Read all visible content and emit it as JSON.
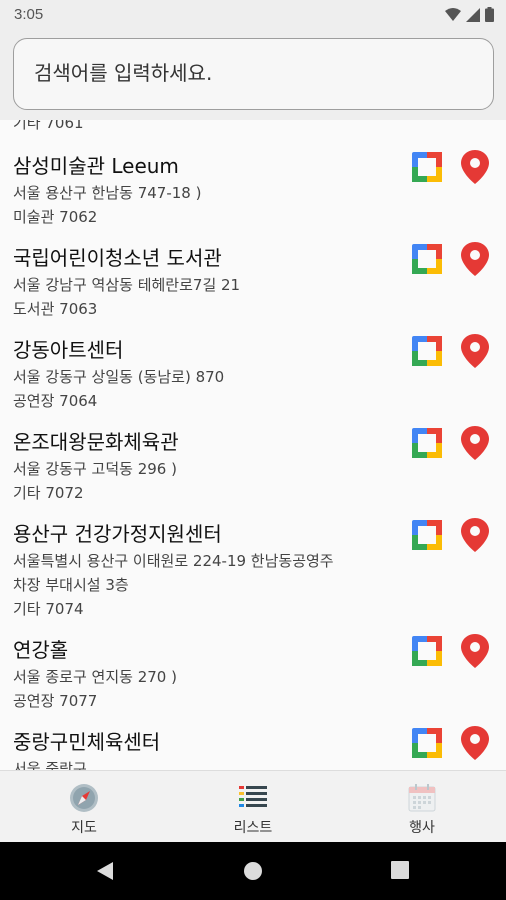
{
  "status": {
    "time": "3:05"
  },
  "search": {
    "placeholder": "검색어를 입력하세요."
  },
  "list": {
    "cut_off_text": "기타 7061",
    "items": [
      {
        "name": "삼성미술관 Leeum",
        "lines": [
          "서울  용산구 한남동 747-18 )",
          "미술관 7062"
        ]
      },
      {
        "name": "국립어린이청소년 도서관",
        "lines": [
          "서울  강남구 역삼동   테헤란로7길 21",
          "도서관 7063"
        ]
      },
      {
        "name": "강동아트센터",
        "lines": [
          "서울  강동구 상일동 (동남로) 870",
          "공연장 7064"
        ]
      },
      {
        "name": "온조대왕문화체육관",
        "lines": [
          "서울  강동구 고덕동 296 )",
          "기타 7072"
        ]
      },
      {
        "name": "용산구 건강가정지원센터",
        "lines": [
          "서울특별시 용산구 이태원로 224-19 한남동공영주",
          "차장 부대시설 3층",
          "기타 7074"
        ]
      },
      {
        "name": "연강홀",
        "lines": [
          "서울  종로구 연지동 270 )",
          "공연장 7077"
        ]
      },
      {
        "name": "중랑구민체육센터",
        "lines": [
          "서울  중랑구"
        ]
      }
    ]
  },
  "bottom_nav": {
    "map": "지도",
    "list": "리스트",
    "event": "행사"
  },
  "colors": {
    "pin": "#e53935",
    "map_blue": "#4285f4",
    "map_green": "#34a853",
    "map_yellow": "#fbbc05",
    "map_red": "#ea4335"
  }
}
